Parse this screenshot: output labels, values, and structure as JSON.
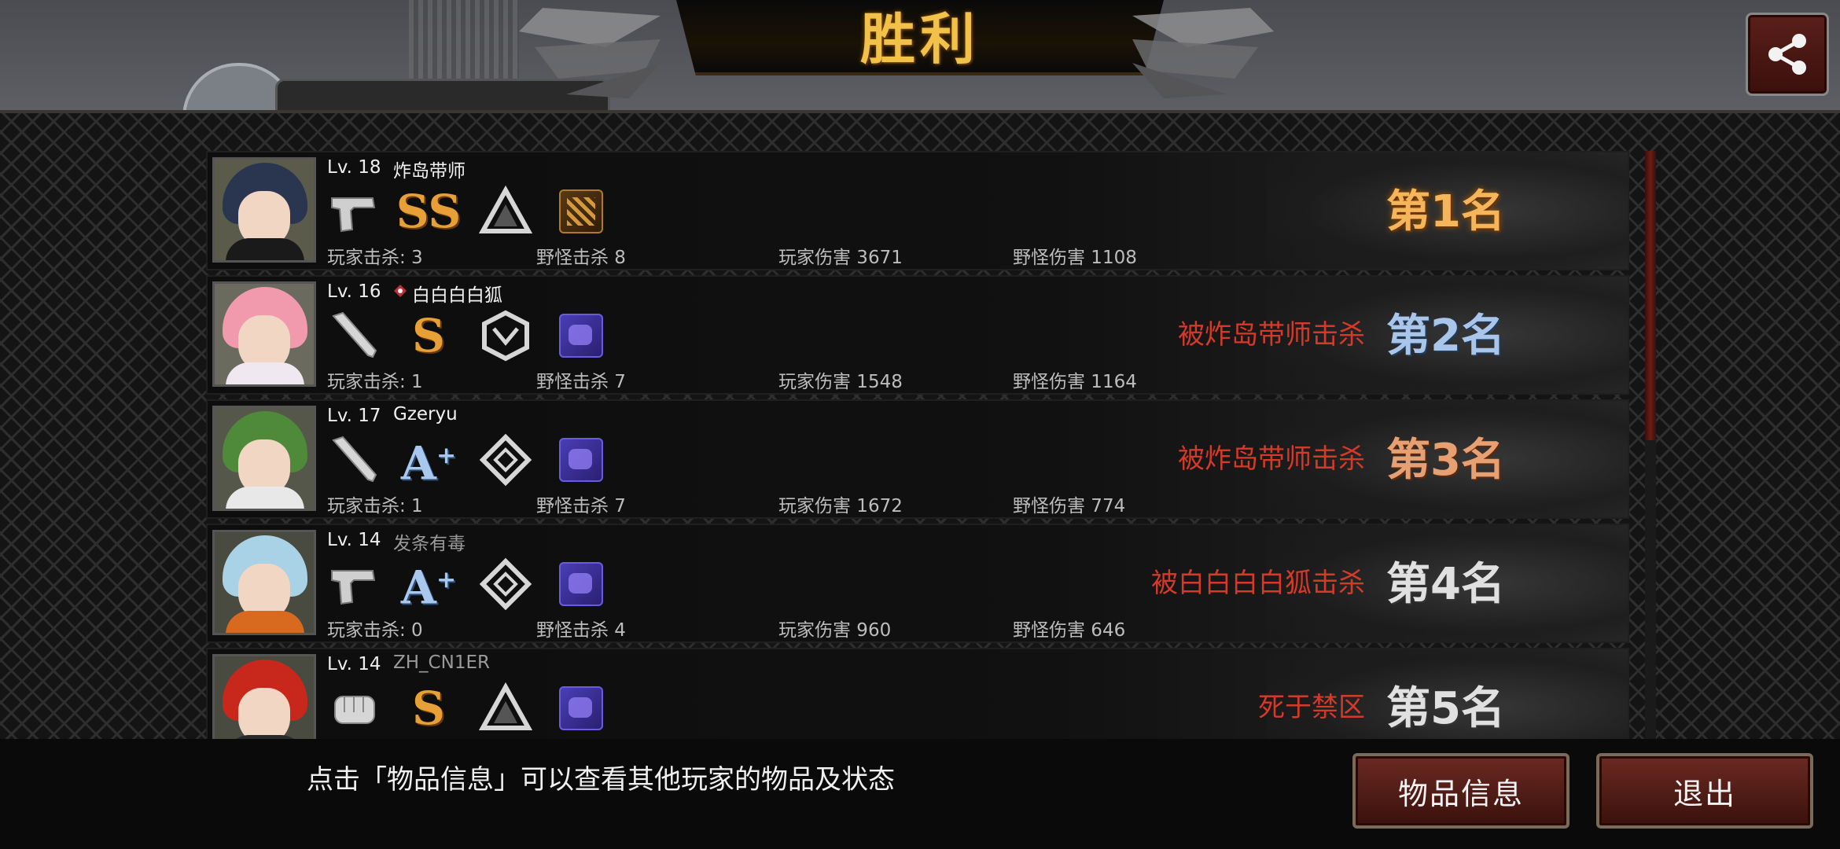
{
  "header": {
    "title": "胜利"
  },
  "players": [
    {
      "level": "Lv. 18",
      "name": "炸岛带师",
      "name_dim": false,
      "weapon": "pistol-icon",
      "grade": "SS",
      "grade_style": "gold",
      "armor": "delta-armor-icon",
      "item": "ammo-icon",
      "stats": {
        "player_kills": "玩家击杀: 3",
        "monster_kills": "野怪击杀 8",
        "player_damage": "玩家伤害 3671",
        "monster_damage": "野怪伤害 1108"
      },
      "result": "",
      "rank": "第1名",
      "rank_style": "r1",
      "avatar": {
        "hair": "#2a3550",
        "body": "#1a1a1a",
        "bg": "#5a5b4a"
      }
    },
    {
      "level": "Lv. 16",
      "name": "白白白白狐",
      "name_dim": false,
      "clan_icon": true,
      "weapon": "bat-icon",
      "grade": "S",
      "grade_style": "gold",
      "armor": "hex-armor-icon",
      "item": "bag-icon",
      "stats": {
        "player_kills": "玩家击杀: 1",
        "monster_kills": "野怪击杀 7",
        "player_damage": "玩家伤害 1548",
        "monster_damage": "野怪伤害 1164"
      },
      "result": "被炸岛带师击杀",
      "rank": "第2名",
      "rank_style": "r2",
      "avatar": {
        "hair": "#f19aae",
        "body": "#f0e8f0",
        "bg": "#6a6a5e"
      }
    },
    {
      "level": "Lv. 17",
      "name": "Gzeryu",
      "name_dim": false,
      "weapon": "bat-icon",
      "grade": "A+",
      "grade_style": "blue",
      "armor": "diamond-armor-icon",
      "item": "bag-icon",
      "stats": {
        "player_kills": "玩家击杀: 1",
        "monster_kills": "野怪击杀 7",
        "player_damage": "玩家伤害 1672",
        "monster_damage": "野怪伤害 774"
      },
      "result": "被炸岛带师击杀",
      "rank": "第3名",
      "rank_style": "r3",
      "avatar": {
        "hair": "#4e8a3a",
        "body": "#e8e8e8",
        "bg": "#55574a"
      }
    },
    {
      "level": "Lv. 14",
      "name": "发条有毒",
      "name_dim": true,
      "weapon": "pistol-icon",
      "grade": "A+",
      "grade_style": "blue",
      "armor": "diamond-armor-icon",
      "item": "bag-icon",
      "stats": {
        "player_kills": "玩家击杀: 0",
        "monster_kills": "野怪击杀 4",
        "player_damage": "玩家伤害 960",
        "monster_damage": "野怪伤害 646"
      },
      "result": "被白白白白狐击杀",
      "rank": "第4名",
      "rank_style": "rn",
      "avatar": {
        "hair": "#a9d2e6",
        "body": "#d86a20",
        "bg": "#4a4b40"
      }
    },
    {
      "level": "Lv. 14",
      "name": "ZH_CN1ER",
      "name_dim": true,
      "weapon": "fist-icon",
      "grade": "S",
      "grade_style": "gold",
      "armor": "delta-armor-icon",
      "item": "bag-icon",
      "stats": {
        "player_kills": "",
        "monster_kills": "",
        "player_damage": "",
        "monster_damage": ""
      },
      "result": "死于禁区",
      "rank": "第5名",
      "rank_style": "rn",
      "avatar": {
        "hair": "#c8281c",
        "body": "#2a2a2a",
        "bg": "#4a4b40"
      }
    }
  ],
  "footer": {
    "hint": "点击「物品信息」可以查看其他玩家的物品及状态",
    "items_button": "物品信息",
    "exit_button": "退出"
  },
  "colors": {
    "accent_gold": "#f2c14a",
    "kill_red": "#d43a2a",
    "button_red": "#6a2a22"
  }
}
